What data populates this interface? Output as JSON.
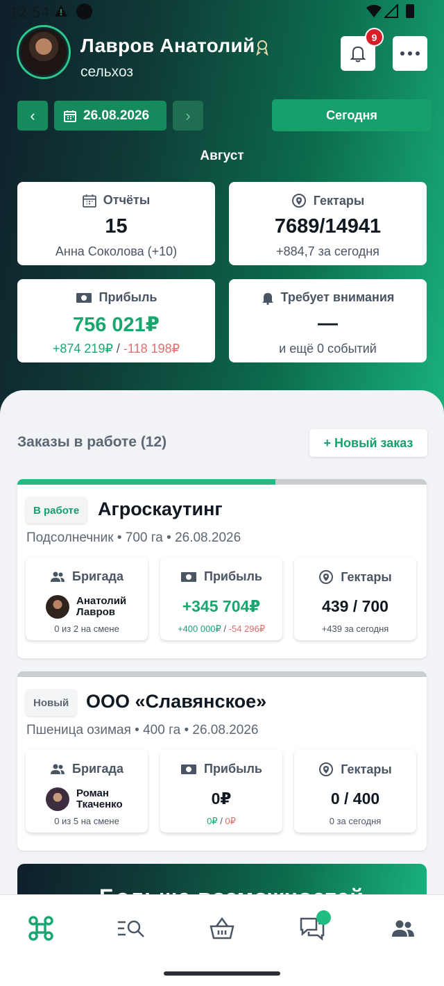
{
  "status_bar": {
    "time": "12:54"
  },
  "header": {
    "user_name": "Лавров Анатолий",
    "user_role": "сельхоз",
    "notification_count": "9"
  },
  "date_nav": {
    "date": "26.08.2026",
    "today_label": "Сегодня"
  },
  "month": "Август",
  "stats": {
    "reports": {
      "label": "Отчёты",
      "value": "15",
      "sub": "Анна Соколова (+10)"
    },
    "hectares": {
      "label": "Гектары",
      "value": "7689/14941",
      "sub": "+884,7 за сегодня"
    },
    "profit": {
      "label": "Прибыль",
      "value": "756 021₽",
      "plus": "+874 219₽",
      "sep": " / ",
      "minus": "-118 198₽"
    },
    "attention": {
      "label": "Требует внимания",
      "value": "—",
      "sub": "и ещё 0 событий"
    }
  },
  "orders": {
    "title": "Заказы в работе (12)",
    "new_label": "+ Новый заказ",
    "items": [
      {
        "status": "В работе",
        "status_color": "#17a06b",
        "progress": 0.63,
        "name": "Агроскаутинг",
        "meta": "Подсолнечник • 700 га • 26.08.2026",
        "brigade_label": "Бригада",
        "worker_first": "Анатолий",
        "worker_last": "Лавров",
        "shift": "0 из 2 на смене",
        "profit_label": "Прибыль",
        "profit": "+345 704₽",
        "profit_plus": "+400 000₽",
        "profit_sep": " / ",
        "profit_minus": "-54 296₽",
        "hectares_label": "Гектары",
        "hectares": "439 / 700",
        "hectares_today": "+439 за сегодня"
      },
      {
        "status": "Новый",
        "status_color": "#5c6773",
        "progress": 0,
        "name": "ООО «Славянское»",
        "meta": "Пшеница озимая • 400 га • 26.08.2026",
        "brigade_label": "Бригада",
        "worker_first": "Роман",
        "worker_last": "Ткаченко",
        "shift": "0 из 5 на смене",
        "profit_label": "Прибыль",
        "profit": "0₽",
        "profit_plus": "0₽",
        "profit_sep": " / ",
        "profit_minus": "0₽",
        "hectares_label": "Гектары",
        "hectares": "0 / 400",
        "hectares_today": "0 за сегодня"
      }
    ]
  },
  "promo": {
    "title": "Больше возможностей"
  },
  "colors": {
    "accent": "#17a06b",
    "negative": "#e16d6d",
    "badge": "#d71f2a"
  },
  "bottom_nav": [
    "drone-icon",
    "search-list-icon",
    "basket-icon",
    "chat-icon",
    "team-icon"
  ]
}
